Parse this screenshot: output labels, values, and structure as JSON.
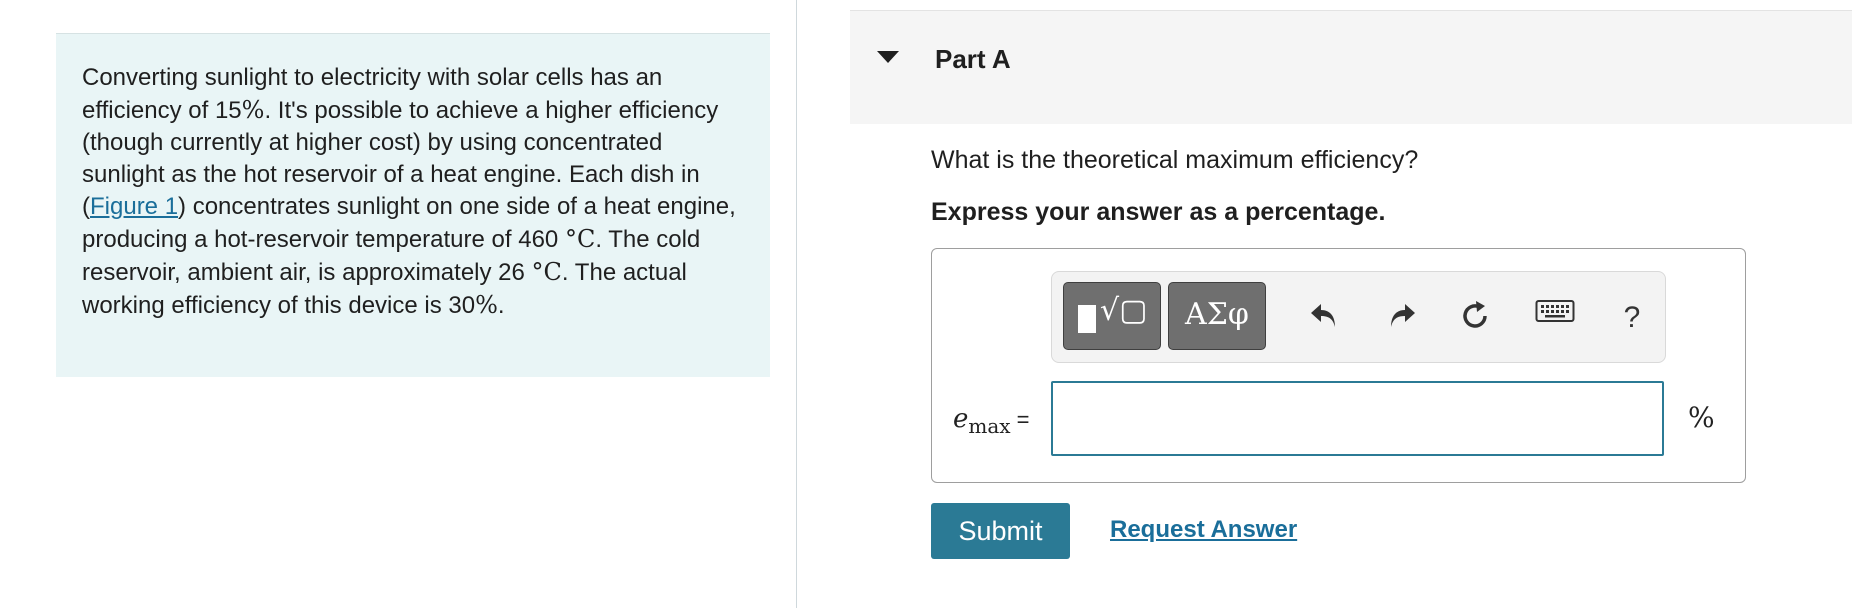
{
  "problem": {
    "seg1": "Converting sunlight to electricity with solar cells has an efficiency of 15",
    "pct1": "%",
    "seg2": ". It's possible to achieve a higher efficiency (though currently at higher cost) by using concentrated sunlight as the hot reservoir of a heat engine. Each dish in (",
    "link": "Figure 1",
    "seg3": ") concentrates sunlight on one side of a heat engine, producing a hot-reservoir temperature of 460 ",
    "unit1": "°C",
    "seg4": ". The cold reservoir, ambient air, is approximately 26 ",
    "unit2": "°C",
    "seg5": ". The actual working efficiency of this device is 30",
    "pct2": "%",
    "seg6": "."
  },
  "part": {
    "title": "Part A"
  },
  "question": "What is the theoretical maximum efficiency?",
  "instruction": "Express your answer as a percentage.",
  "toolbar": {
    "templates_icon": "templates-icon",
    "symbols_label": "ΑΣφ",
    "undo_icon": "undo-icon",
    "redo_icon": "redo-icon",
    "reset_icon": "reset-icon",
    "keyboard_icon": "keyboard-icon",
    "help_label": "?"
  },
  "answer": {
    "var": "e",
    "sub": "max",
    "eq": " =",
    "value": "",
    "unit": "%"
  },
  "buttons": {
    "submit": "Submit",
    "request": "Request Answer"
  },
  "colors": {
    "accent": "#2b7a95",
    "link": "#1a6e9a",
    "panel_bg": "#e9f5f6"
  }
}
